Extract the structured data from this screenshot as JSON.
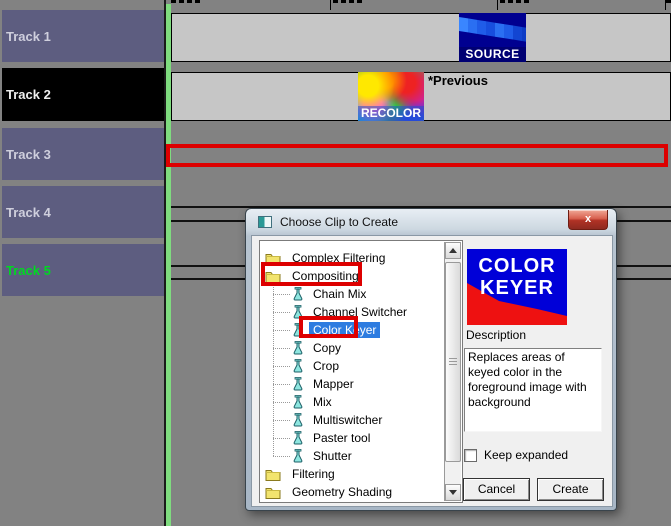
{
  "timeline": {
    "tracks": [
      {
        "label": "Track 1"
      },
      {
        "label": "Track 2"
      },
      {
        "label": "Track 3"
      },
      {
        "label": "Track 4"
      },
      {
        "label": "Track 5"
      }
    ],
    "clips": {
      "source_label": "SOURCE",
      "recolor_label": "RECOLOR",
      "previous_label": "*Previous"
    }
  },
  "dialog": {
    "title": "Choose Clip to Create",
    "close_glyph": "x",
    "tree": {
      "items": [
        {
          "label": "Complex Filtering",
          "type": "folder"
        },
        {
          "label": "Compositing",
          "type": "folder",
          "annotated": true
        },
        {
          "label": "Chain Mix",
          "type": "tool"
        },
        {
          "label": "Channel Switcher",
          "type": "tool"
        },
        {
          "label": "Color Keyer",
          "type": "tool",
          "selected": true,
          "annotated": true
        },
        {
          "label": "Copy",
          "type": "tool"
        },
        {
          "label": "Crop",
          "type": "tool"
        },
        {
          "label": "Mapper",
          "type": "tool"
        },
        {
          "label": "Mix",
          "type": "tool"
        },
        {
          "label": "Multiswitcher",
          "type": "tool"
        },
        {
          "label": "Paster tool",
          "type": "tool"
        },
        {
          "label": "Shutter",
          "type": "tool"
        },
        {
          "label": "Filtering",
          "type": "folder"
        },
        {
          "label": "Geometry Shading",
          "type": "folder"
        }
      ]
    },
    "preview": {
      "line1": "COLOR",
      "line2": "KEYER"
    },
    "description_label": "Description",
    "description_text": "Replaces areas of keyed color in the foreground image with background",
    "checkbox_label": "Keep expanded",
    "cancel_label": "Cancel",
    "create_label": "Create"
  },
  "colors": {
    "annotation_red": "#dd0000",
    "selection_blue": "#2d7ce0",
    "track_label_purple": "#5d5d80",
    "track5_text_green": "#00d822",
    "timeline_green_line": "#7fdc7f",
    "preview_blue": "#0000d8",
    "preview_red": "#ee1111"
  }
}
